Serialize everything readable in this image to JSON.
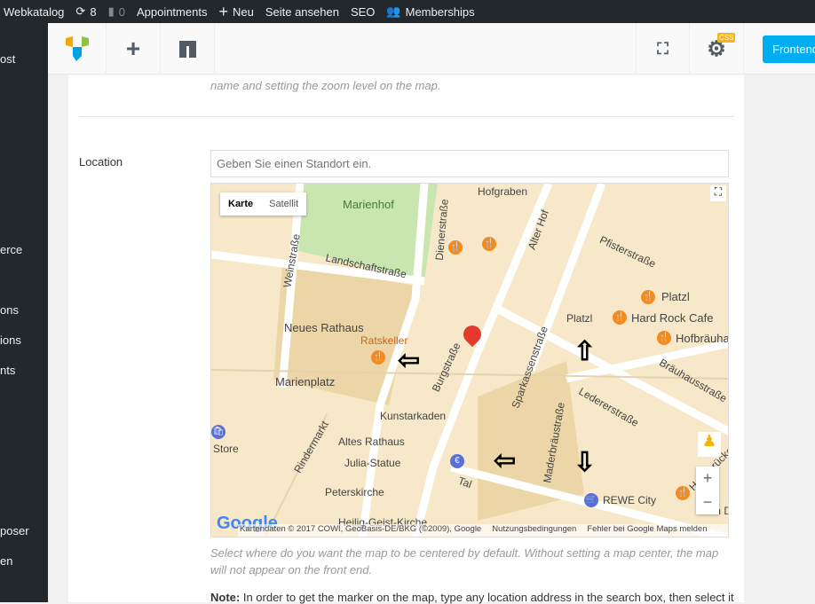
{
  "adminbar": {
    "site": "Webkatalog",
    "updates": "8",
    "comments": "0",
    "items": [
      "Appointments",
      "Neu",
      "Seite ansehen",
      "SEO",
      "Memberships"
    ]
  },
  "sidebar": [
    "ost",
    "erce",
    "ons",
    "ions",
    "nts",
    "poser",
    "en"
  ],
  "toolbar": {
    "css_badge": "CSS",
    "frontend": "Frontend"
  },
  "panel": {
    "prev_help": "name and setting the zoom level on the map.",
    "location_label": "Location",
    "search_placeholder": "Geben Sie einen Standort ein.",
    "help": "Select where do you want the map to be centered by default. Without setting a map center, the map will not appear on the front end.",
    "note_label": "Note:",
    "note": " In order to get the marker on the map, type any location address in the search box, then select it"
  },
  "map": {
    "tabs": [
      "Karte",
      "Satellit"
    ],
    "labels": [
      "Hofgraben",
      "Marienhof",
      "Weinstraße",
      "Landschaftstraße",
      "Dienerstraße",
      "Alter Hof",
      "Pfisterstraße",
      "Platzl",
      "Hard Rock Cafe",
      "Hofbräuhaus",
      "Neues Rathaus",
      "Ratskeller",
      "Marienplatz",
      "Burgstraße",
      "Sparkassenstraße",
      "Ledererstraße",
      "Bräuhausstraße",
      "Kunstarkaden",
      "Altes Rathaus",
      "Julia-Statue",
      "Peterskirche",
      "Rindermarkt",
      "Maderbräustraße",
      "REWE City",
      "Zum D",
      "Heilig-Geist-Kirche",
      "Store",
      "Tal",
      "Hochbrückenstraße"
    ],
    "attribution": "Kartendaten © 2017 COWI, GeoBasis-DE/BKG (©2009), Google",
    "terms": "Nutzungsbedingungen",
    "report": "Fehler bei Google Maps melden",
    "zoom_in": "+",
    "zoom_out": "−",
    "logo": "Google"
  }
}
